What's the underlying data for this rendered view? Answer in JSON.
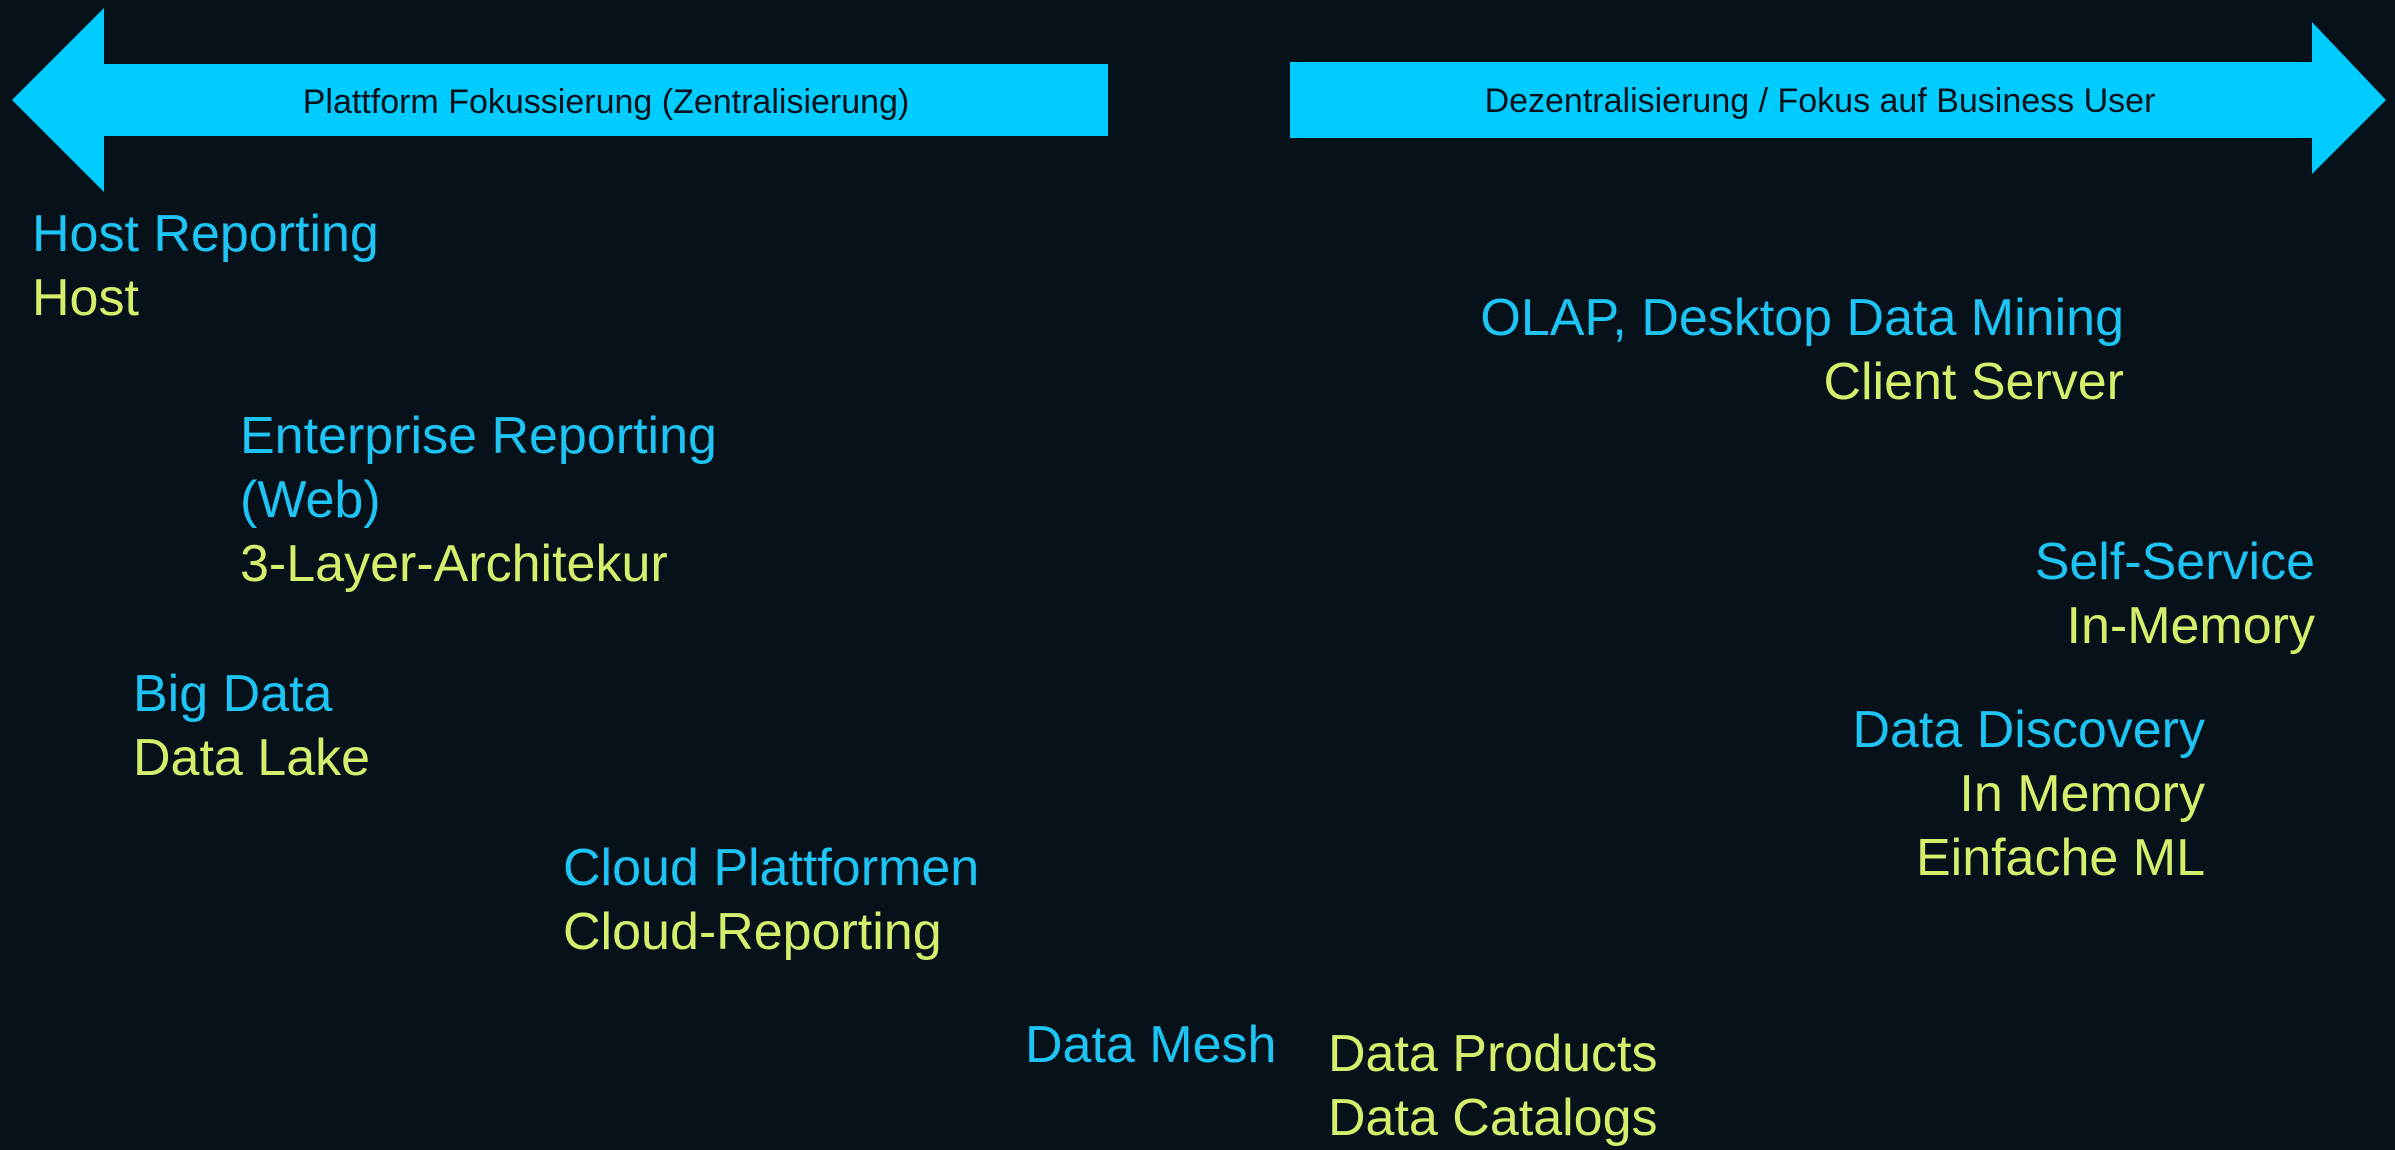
{
  "colors": {
    "background": "#07111a",
    "arrow": "#00ccff",
    "title": "#1ec4f4",
    "subtitle": "#d5ef6d"
  },
  "arrows": {
    "left_label": "Plattform Fokussierung (Zentralisierung)",
    "right_label": "Dezentralisierung / Fokus auf Business User"
  },
  "left_items": {
    "host": {
      "title": "Host Reporting",
      "sub": "Host"
    },
    "enterprise": {
      "title_line1": "Enterprise Reporting",
      "title_line2": "(Web)",
      "sub": "3-Layer-Architekur"
    },
    "bigdata": {
      "title": "Big Data",
      "sub": "Data Lake"
    },
    "cloud": {
      "title": "Cloud Plattformen",
      "sub": "Cloud-Reporting"
    }
  },
  "right_items": {
    "olap": {
      "title": "OLAP, Desktop Data Mining",
      "sub": "Client Server"
    },
    "selfservice": {
      "title": "Self-Service",
      "sub": "In-Memory"
    },
    "discovery": {
      "title": "Data Discovery",
      "sub1": "In Memory",
      "sub2": "Einfache ML"
    }
  },
  "bottom": {
    "mesh_title": "Data Mesh",
    "mesh_sub1": "Data Products",
    "mesh_sub2": "Data Catalogs"
  }
}
